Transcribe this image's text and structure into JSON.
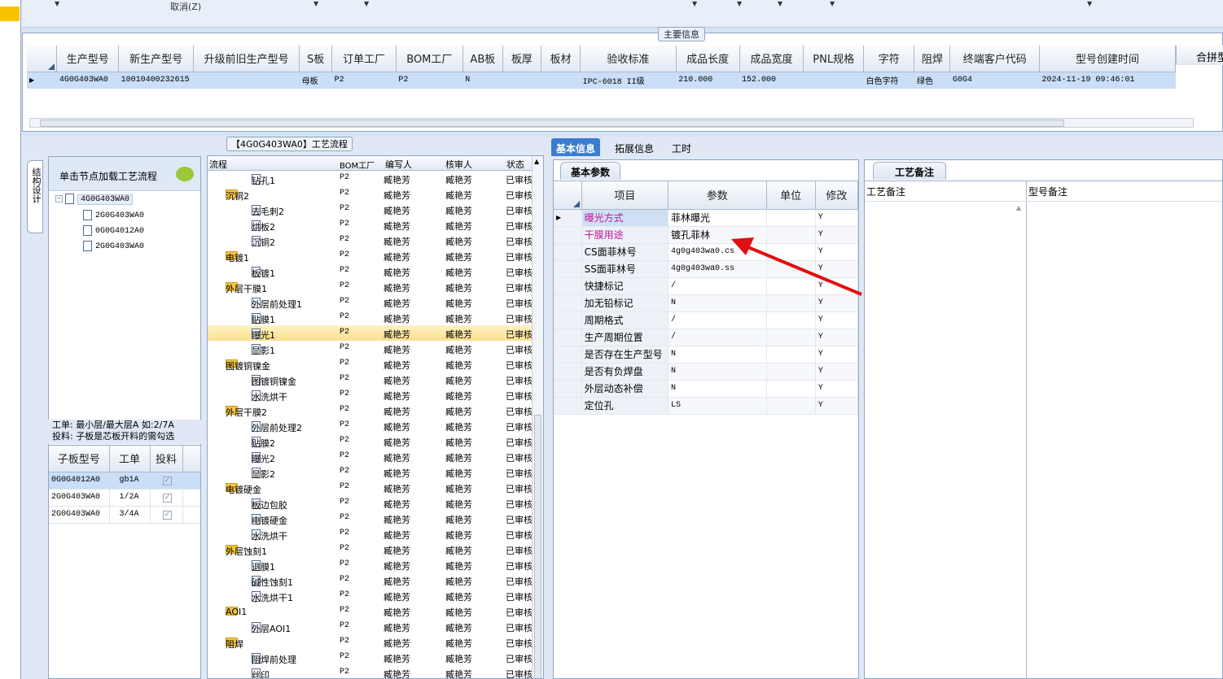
{
  "topbar": {
    "cancel": "取消(Z)"
  },
  "main": {
    "legend": "主要信息",
    "headers": [
      "生产型号",
      "新生产型号",
      "升级前旧生产型号",
      "S板",
      "订单工厂",
      "BOM工厂",
      "AB板",
      "板厚",
      "板材",
      "验收标准",
      "成品长度",
      "成品宽度",
      "PNL规格",
      "字符",
      "阻焊",
      "终端客户代码",
      "型号创建时间"
    ],
    "side_header": "合拼型",
    "row": [
      "4G0G403WA0",
      "10010400232615",
      "",
      "母板",
      "P2",
      "P2",
      "N",
      "",
      "",
      "IPC-6018 II级",
      "210.000",
      "152.000",
      "",
      "白色字符",
      "绿色",
      "G0G4",
      "2024-11-19 09:46:01"
    ]
  },
  "left": {
    "tab_label": "结构设计",
    "header": "单击节点加载工艺流程",
    "tree_root": "4G0G403WA0",
    "tree_children": [
      "2G0G403WA0",
      "0G0G4012A0",
      "2G0G403WA0"
    ],
    "note1": "工单: 最小层/最大层A 如:2/7A",
    "note2": "投料: 子板是芯板开料的需勾选",
    "sub_headers": [
      "子板型号",
      "工单",
      "投料"
    ],
    "sub_rows": [
      [
        "0G0G4012A0",
        "gb1A"
      ],
      [
        "2G0G403WA0",
        "1/2A"
      ],
      [
        "2G0G403WA0",
        "3/4A"
      ]
    ]
  },
  "flow": {
    "title": "【4G0G403WA0】工艺流程",
    "headers": [
      "流程",
      "BOM工厂",
      "编写人",
      "核审人",
      "状态"
    ],
    "rows": [
      {
        "name": "钻孔1",
        "folder": false,
        "bom": "P2",
        "writer": "臧艳芳",
        "reviewer": "臧艳芳",
        "status": "已审核"
      },
      {
        "name": "沉铜2",
        "folder": true,
        "bom": "P2",
        "writer": "臧艳芳",
        "reviewer": "臧艳芳",
        "status": "已审核"
      },
      {
        "name": "去毛刺2",
        "folder": false,
        "bom": "P2",
        "writer": "臧艳芳",
        "reviewer": "臧艳芳",
        "status": "已审核"
      },
      {
        "name": "烘板2",
        "folder": false,
        "bom": "P2",
        "writer": "臧艳芳",
        "reviewer": "臧艳芳",
        "status": "已审核"
      },
      {
        "name": "沉铜2",
        "folder": false,
        "bom": "P2",
        "writer": "臧艳芳",
        "reviewer": "臧艳芳",
        "status": "已审核"
      },
      {
        "name": "电镀1",
        "folder": true,
        "bom": "P2",
        "writer": "臧艳芳",
        "reviewer": "臧艳芳",
        "status": "已审核"
      },
      {
        "name": "板镀1",
        "folder": false,
        "bom": "P2",
        "writer": "臧艳芳",
        "reviewer": "臧艳芳",
        "status": "已审核"
      },
      {
        "name": "外层干膜1",
        "folder": true,
        "bom": "P2",
        "writer": "臧艳芳",
        "reviewer": "臧艳芳",
        "status": "已审核"
      },
      {
        "name": "外层前处理1",
        "folder": false,
        "bom": "P2",
        "writer": "臧艳芳",
        "reviewer": "臧艳芳",
        "status": "已审核"
      },
      {
        "name": "贴膜1",
        "folder": false,
        "bom": "P2",
        "writer": "臧艳芳",
        "reviewer": "臧艳芳",
        "status": "已审核"
      },
      {
        "name": "曝光1",
        "folder": false,
        "bom": "P2",
        "writer": "臧艳芳",
        "reviewer": "臧艳芳",
        "status": "已审核",
        "selected": true
      },
      {
        "name": "显影1",
        "folder": false,
        "bom": "P2",
        "writer": "臧艳芳",
        "reviewer": "臧艳芳",
        "status": "已审核"
      },
      {
        "name": "图镀铜镍金",
        "folder": true,
        "bom": "P2",
        "writer": "臧艳芳",
        "reviewer": "臧艳芳",
        "status": "已审核"
      },
      {
        "name": "图镀铜镍金",
        "folder": false,
        "bom": "P2",
        "writer": "臧艳芳",
        "reviewer": "臧艳芳",
        "status": "已审核"
      },
      {
        "name": "水洗烘干",
        "folder": false,
        "bom": "P2",
        "writer": "臧艳芳",
        "reviewer": "臧艳芳",
        "status": "已审核"
      },
      {
        "name": "外层干膜2",
        "folder": true,
        "bom": "P2",
        "writer": "臧艳芳",
        "reviewer": "臧艳芳",
        "status": "已审核"
      },
      {
        "name": "外层前处理2",
        "folder": false,
        "bom": "P2",
        "writer": "臧艳芳",
        "reviewer": "臧艳芳",
        "status": "已审核"
      },
      {
        "name": "贴膜2",
        "folder": false,
        "bom": "P2",
        "writer": "臧艳芳",
        "reviewer": "臧艳芳",
        "status": "已审核"
      },
      {
        "name": "曝光2",
        "folder": false,
        "bom": "P2",
        "writer": "臧艳芳",
        "reviewer": "臧艳芳",
        "status": "已审核"
      },
      {
        "name": "显影2",
        "folder": false,
        "bom": "P2",
        "writer": "臧艳芳",
        "reviewer": "臧艳芳",
        "status": "已审核"
      },
      {
        "name": "电镀硬金",
        "folder": true,
        "bom": "P2",
        "writer": "臧艳芳",
        "reviewer": "臧艳芳",
        "status": "已审核"
      },
      {
        "name": "板边包胶",
        "folder": false,
        "bom": "P2",
        "writer": "臧艳芳",
        "reviewer": "臧艳芳",
        "status": "已审核"
      },
      {
        "name": "电镀硬金",
        "folder": false,
        "bom": "P2",
        "writer": "臧艳芳",
        "reviewer": "臧艳芳",
        "status": "已审核"
      },
      {
        "name": "水洗烘干",
        "folder": false,
        "bom": "P2",
        "writer": "臧艳芳",
        "reviewer": "臧艳芳",
        "status": "已审核"
      },
      {
        "name": "外层蚀刻1",
        "folder": true,
        "bom": "P2",
        "writer": "臧艳芳",
        "reviewer": "臧艳芳",
        "status": "已审核"
      },
      {
        "name": "退膜1",
        "folder": false,
        "bom": "P2",
        "writer": "臧艳芳",
        "reviewer": "臧艳芳",
        "status": "已审核"
      },
      {
        "name": "碱性蚀刻1",
        "folder": false,
        "bom": "P2",
        "writer": "臧艳芳",
        "reviewer": "臧艳芳",
        "status": "已审核"
      },
      {
        "name": "水洗烘干1",
        "folder": false,
        "bom": "P2",
        "writer": "臧艳芳",
        "reviewer": "臧艳芳",
        "status": "已审核"
      },
      {
        "name": "AOI1",
        "folder": true,
        "bom": "P2",
        "writer": "臧艳芳",
        "reviewer": "臧艳芳",
        "status": "已审核"
      },
      {
        "name": "外层AOI1",
        "folder": false,
        "bom": "P2",
        "writer": "臧艳芳",
        "reviewer": "臧艳芳",
        "status": "已审核"
      },
      {
        "name": "阻焊",
        "folder": true,
        "bom": "P2",
        "writer": "臧艳芳",
        "reviewer": "臧艳芳",
        "status": "已审核"
      },
      {
        "name": "阻焊前处理",
        "folder": false,
        "bom": "P2",
        "writer": "臧艳芳",
        "reviewer": "臧艳芳",
        "status": "已审核"
      },
      {
        "name": "丝印",
        "folder": false,
        "bom": "P2",
        "writer": "臧艳芳",
        "reviewer": "臧艳芳",
        "status": "已审核"
      }
    ]
  },
  "tabs": [
    "基本信息",
    "拓展信息",
    "工时"
  ],
  "basic": {
    "section": "基本参数",
    "headers": [
      "项目",
      "参数",
      "单位",
      "修改"
    ],
    "rows": [
      {
        "item": "曝光方式",
        "value": "菲林曝光",
        "unit": "",
        "mod": "Y",
        "highlight": true
      },
      {
        "item": "干膜用途",
        "value": "镀孔菲林",
        "unit": "",
        "mod": "Y",
        "highlight": true
      },
      {
        "item": "CS面菲林号",
        "value": "4g0g403wa0.cs",
        "unit": "",
        "mod": "Y"
      },
      {
        "item": "SS面菲林号",
        "value": "4g0g403wa0.ss",
        "unit": "",
        "mod": "Y"
      },
      {
        "item": "快捷标记",
        "value": "/",
        "unit": "",
        "mod": "Y"
      },
      {
        "item": "加无铅标记",
        "value": "N",
        "unit": "",
        "mod": "Y"
      },
      {
        "item": "周期格式",
        "value": "/",
        "unit": "",
        "mod": "Y"
      },
      {
        "item": "生产周期位置",
        "value": "/",
        "unit": "",
        "mod": "Y"
      },
      {
        "item": "是否存在生产型号",
        "value": "N",
        "unit": "",
        "mod": "Y"
      },
      {
        "item": "是否有负焊盘",
        "value": "N",
        "unit": "",
        "mod": "Y"
      },
      {
        "item": "外层动态补偿",
        "value": "N",
        "unit": "",
        "mod": "Y"
      },
      {
        "item": "定位孔",
        "value": "LS",
        "unit": "",
        "mod": "Y"
      }
    ]
  },
  "remarks": {
    "section": "工艺备注",
    "col1": "工艺备注",
    "col2": "型号备注"
  },
  "colors": {
    "accent": "#3a7cd0",
    "selection": "#c9def7",
    "highlight_text": "#c0149a",
    "arrow": "#e01010"
  }
}
